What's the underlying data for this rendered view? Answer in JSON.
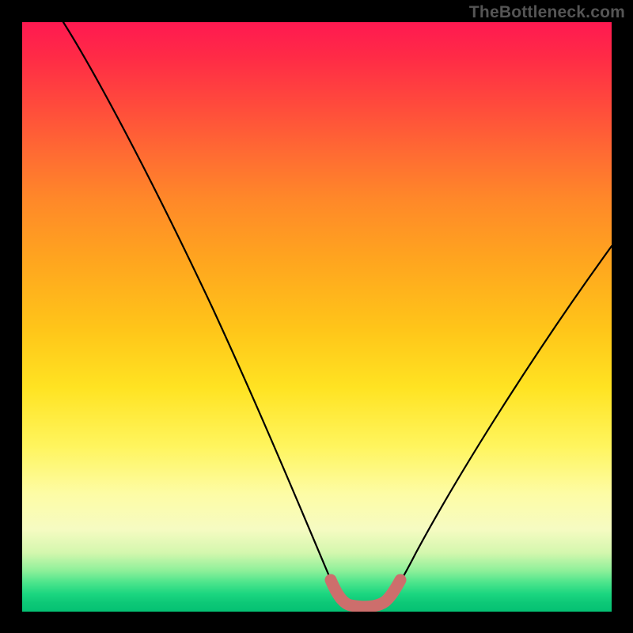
{
  "watermark": "TheBottleneck.com",
  "chart_data": {
    "type": "line",
    "title": "",
    "xlabel": "",
    "ylabel": "",
    "xlim": [
      0,
      100
    ],
    "ylim": [
      0,
      100
    ],
    "series": [
      {
        "name": "bottleneck-curve",
        "x": [
          7,
          10,
          14,
          18,
          22,
          26,
          30,
          34,
          38,
          42,
          46,
          50,
          52,
          54,
          56,
          58,
          60,
          62,
          64,
          68,
          72,
          76,
          80,
          84,
          88,
          92,
          96,
          100
        ],
        "values": [
          100,
          94,
          87,
          80,
          72.5,
          65,
          57.5,
          50,
          42,
          34,
          25,
          14,
          9,
          4.5,
          2,
          1.3,
          1.3,
          2,
          4.5,
          10,
          17,
          24,
          31,
          37.5,
          44,
          50,
          56,
          62
        ]
      },
      {
        "name": "optimal-band",
        "x": [
          52.5,
          54,
          56,
          58,
          60,
          61.5
        ],
        "values": [
          4.2,
          2.2,
          1.4,
          1.4,
          2.2,
          4.2
        ]
      }
    ],
    "colors": {
      "curve": "#000000",
      "optimal_band": "#cd6e6c",
      "gradient_top": "#ff1951",
      "gradient_mid": "#ffe322",
      "gradient_bottom": "#05c173"
    }
  }
}
